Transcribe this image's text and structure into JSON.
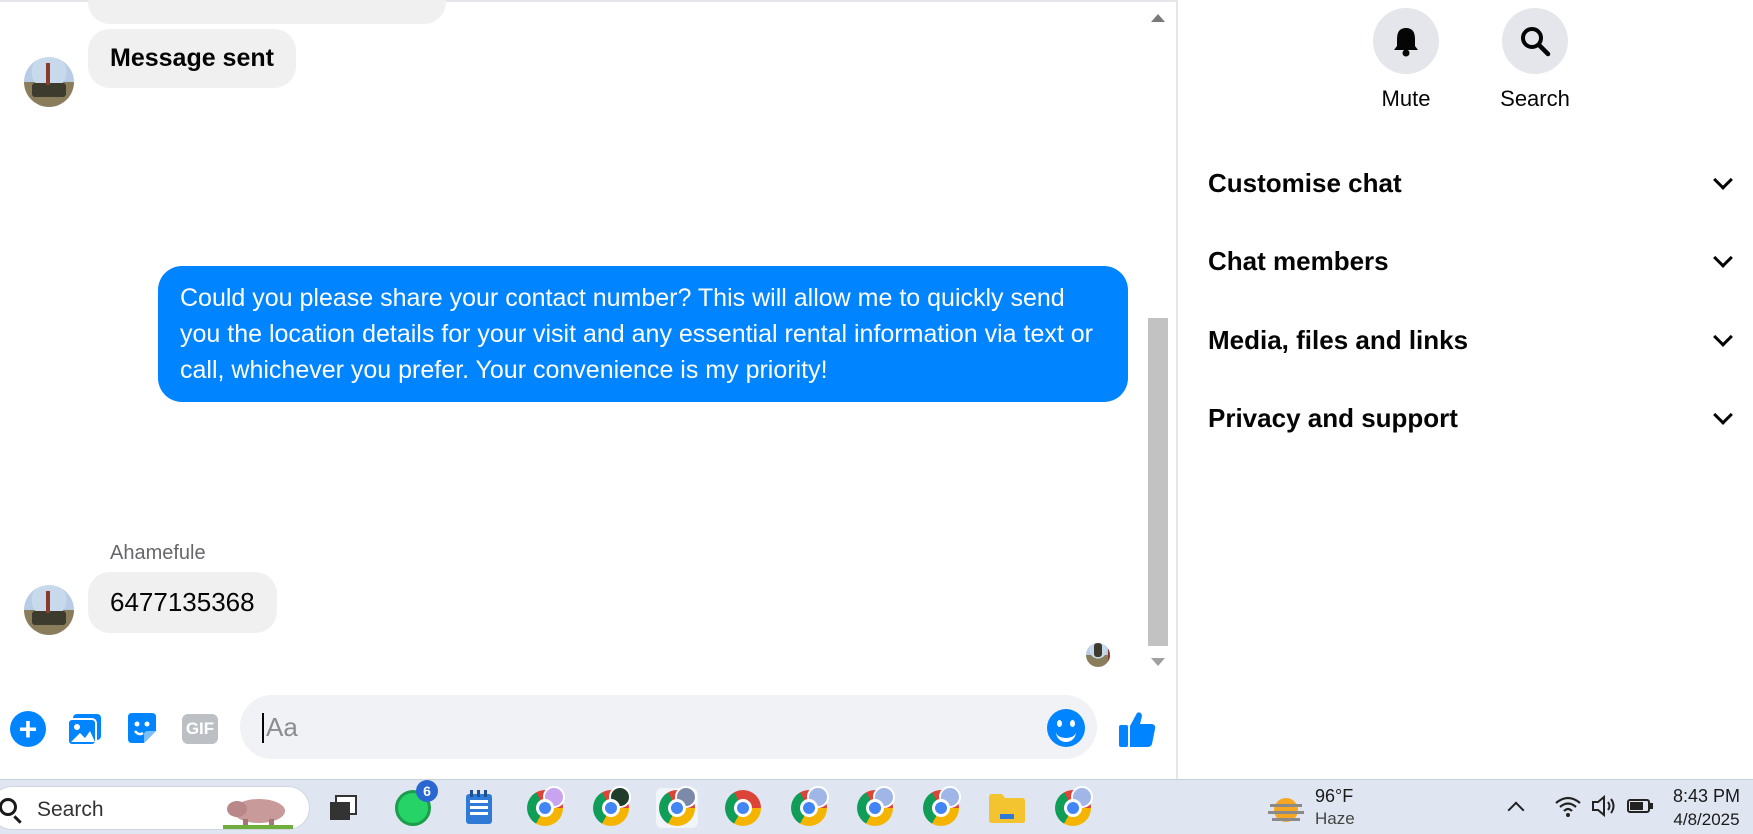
{
  "chat": {
    "messages": [
      {
        "from": "contact",
        "text": "Message sent"
      },
      {
        "from": "me",
        "text": "Could you please share your contact number? This will allow me to quickly send you the location details for your visit and any essential rental information via text or call, whichever you prefer. Your convenience is my priority!"
      },
      {
        "from": "contact",
        "sender": "Ahamefule",
        "text": "6477135368"
      }
    ]
  },
  "composer": {
    "placeholder": "Aa",
    "icons": [
      "plus-icon",
      "photo-icon",
      "sticker-icon",
      "gif-icon",
      "emoji-icon",
      "like-icon"
    ],
    "gif_label": "GIF"
  },
  "panel": {
    "actions": [
      {
        "icon": "bell-icon",
        "label": "Mute"
      },
      {
        "icon": "search-icon",
        "label": "Search"
      }
    ],
    "sections": [
      {
        "label": "Customise chat"
      },
      {
        "label": "Chat members"
      },
      {
        "label": "Media, files and links"
      },
      {
        "label": "Privacy and support"
      }
    ]
  },
  "taskbar": {
    "search_label": "Search",
    "whatsapp_badge": "6",
    "weather": {
      "temp": "96°F",
      "condition": "Haze"
    },
    "time": "8:43 PM",
    "date": "4/8/2025"
  },
  "colors": {
    "outgoing_bubble": "#0084ff",
    "incoming_bubble": "#f0f0f0",
    "accent": "#0084ff"
  }
}
